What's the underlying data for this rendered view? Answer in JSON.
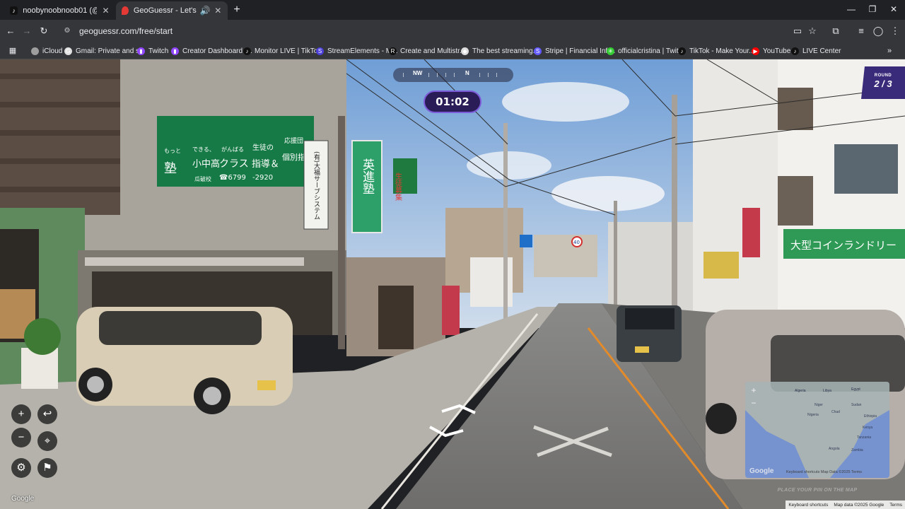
{
  "tabs": [
    {
      "title": "noobynoobnoob01 (@officialc",
      "icon": "tiktok-icon",
      "active": false
    },
    {
      "title": "GeoGuessr - Let's explore t",
      "icon": "geoguessr-pin-icon",
      "active": true
    }
  ],
  "address_bar": {
    "url": "geoguessr.com/free/start"
  },
  "bookmarks": [
    {
      "label": "iCloud",
      "icon": "apple-icon",
      "color": "#9e9e9e"
    },
    {
      "label": "Gmail: Private and s...",
      "icon": "gmx-icon",
      "color": "#e0e0e0"
    },
    {
      "label": "Twitch",
      "icon": "twitch-icon",
      "color": "#9146ff"
    },
    {
      "label": "Creator Dashboard |...",
      "icon": "twitch-icon",
      "color": "#9146ff"
    },
    {
      "label": "Monitor LIVE | TikTo...",
      "icon": "tiktok-icon",
      "color": "#111111"
    },
    {
      "label": "StreamElements - M...",
      "icon": "streamelements-icon",
      "color": "#4b3fd8"
    },
    {
      "label": "Create and Multistr...",
      "icon": "restream-icon",
      "color": "#111111"
    },
    {
      "label": "The best streaming...",
      "icon": "diamond-icon",
      "color": "#dddddd"
    },
    {
      "label": "Stripe | Financial Infr...",
      "icon": "stripe-icon",
      "color": "#635bff"
    },
    {
      "label": "officialcristina | Twit...",
      "icon": "twitter-icon",
      "color": "#33cc33"
    },
    {
      "label": "TikTok - Make Your...",
      "icon": "tiktok-icon",
      "color": "#111111"
    },
    {
      "label": "YouTube",
      "icon": "youtube-icon",
      "color": "#ff0000"
    },
    {
      "label": "LIVE Center",
      "icon": "tiktok-icon",
      "color": "#111111"
    }
  ],
  "game": {
    "timer": "01:02",
    "round_label": "ROUND",
    "round_value": "2 / 3",
    "compass": {
      "left": "NW",
      "center": "N"
    },
    "map": {
      "zoom_in": "+",
      "zoom_out": "−",
      "countries": [
        "Algeria",
        "Libya",
        "Egypt",
        "Niger",
        "Sudan",
        "Nigeria",
        "Chad",
        "Ethiopia",
        "Kenya",
        "Tanzania",
        "Angola",
        "Zambia"
      ],
      "google_logo": "Google",
      "attribution": "Keyboard shortcuts   Map Data ©2025   Terms",
      "cta": "PLACE YOUR PIN ON THE MAP"
    }
  },
  "streetview": {
    "google_logo": "Google",
    "footer": [
      "Keyboard shortcuts",
      "Map data ©2025 Google",
      "Terms"
    ],
    "signs": {
      "green_1": "もっと",
      "green_2": "塾",
      "green_3": "できる、",
      "green_4": "小中高",
      "green_5": "がんばる",
      "green_6": "クラス",
      "green_7": "☎6799",
      "green_8": "生徒の",
      "green_9": "指導＆",
      "green_10": "-2920",
      "green_11": "応援団",
      "green_12": "個別指",
      "branch": "瓜破校",
      "vertical_white": "(有)大福サーブシステム",
      "vertical_green": "英進塾",
      "red_banner": "生徒募集",
      "laundry": "大型コインランドリー",
      "speed": "40"
    }
  },
  "colors": {
    "accent_purple": "#3a2a7a",
    "timer_border": "#7c5bd9",
    "sign_green": "#157a45"
  }
}
